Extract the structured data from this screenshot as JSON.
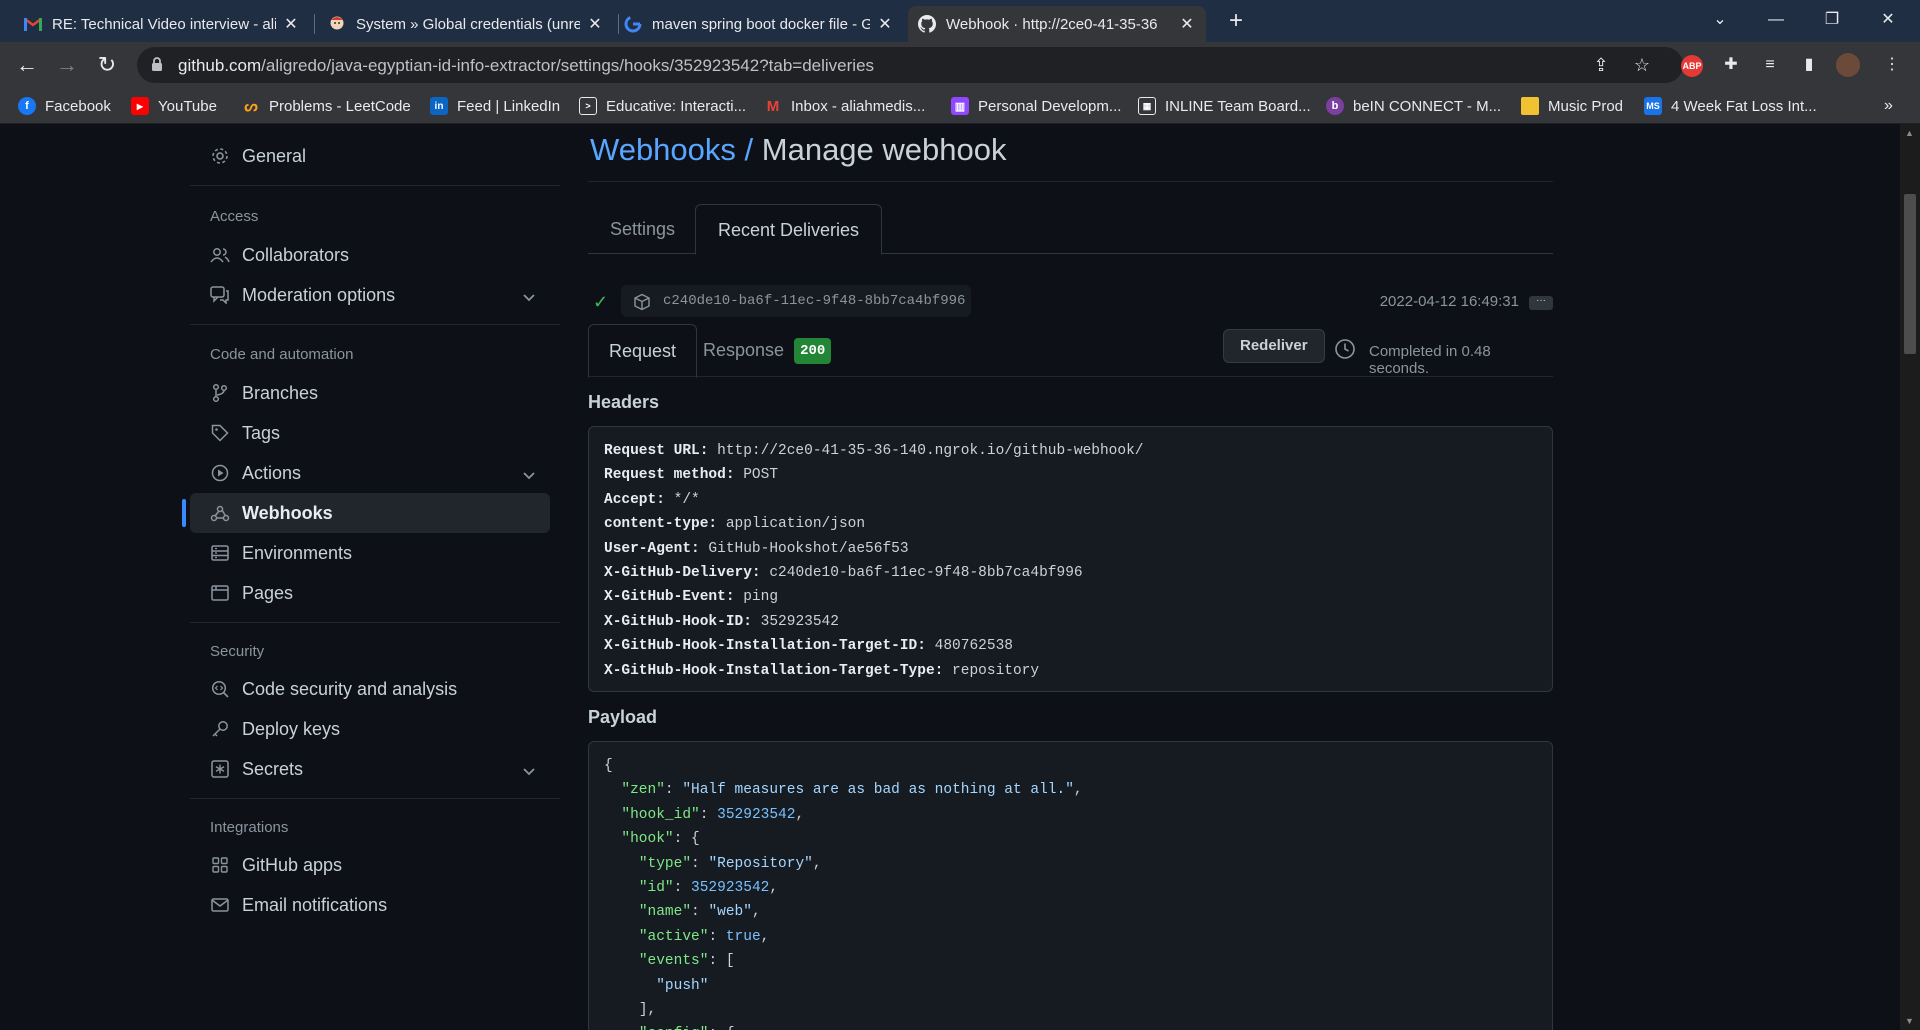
{
  "browser": {
    "tabs": [
      {
        "title": "RE: Technical Video interview - ali",
        "icon": "gmail-icon",
        "active": false
      },
      {
        "title": "System » Global credentials (unre",
        "icon": "jenkins-icon",
        "active": false
      },
      {
        "title": "maven spring boot docker file - G",
        "icon": "google-icon",
        "active": false
      },
      {
        "title": "Webhook · http://2ce0-41-35-36",
        "icon": "github-icon",
        "active": true
      }
    ],
    "url_host": "github.com",
    "url_path": "/aligredo/java-egyptian-id-info-extractor/settings/hooks/352923542?tab=deliveries",
    "bookmarks": [
      {
        "label": "Facebook",
        "icon": "facebook-icon",
        "color": "#1877f2",
        "glyph": "f"
      },
      {
        "label": "YouTube",
        "icon": "youtube-icon",
        "color": "#ff0000",
        "glyph": "▶"
      },
      {
        "label": "Problems - LeetCode",
        "icon": "leetcode-icon",
        "color": "#35363a",
        "glyph": "ᔕ"
      },
      {
        "label": "Feed | LinkedIn",
        "icon": "linkedin-icon",
        "color": "#0a66c2",
        "glyph": "in"
      },
      {
        "label": "Educative: Interacti...",
        "icon": "educative-icon",
        "color": "#35363a",
        "glyph": "▤"
      },
      {
        "label": "Inbox - aliahmedis...",
        "icon": "gmail-icon",
        "color": "#35363a",
        "glyph": "M"
      },
      {
        "label": "Personal Developm...",
        "icon": "twitch-icon",
        "color": "#9146ff",
        "glyph": "ʈ"
      },
      {
        "label": "INLINE Team Board...",
        "icon": "trello-icon",
        "color": "#35363a",
        "glyph": "▦"
      },
      {
        "label": "beIN CONNECT - M...",
        "icon": "bein-icon",
        "color": "#5c2d91",
        "glyph": "b"
      },
      {
        "label": "Music Prod",
        "icon": "folder-icon",
        "color": "#f1c232",
        "glyph": ""
      },
      {
        "label": "4 Week Fat Loss Int...",
        "icon": "ms-icon",
        "color": "#1a73e8",
        "glyph": "MS"
      }
    ]
  },
  "sidebar": {
    "general": "General",
    "access_heading": "Access",
    "collaborators": "Collaborators",
    "moderation": "Moderation options",
    "code_heading": "Code and automation",
    "branches": "Branches",
    "tags": "Tags",
    "actions": "Actions",
    "webhooks": "Webhooks",
    "environments": "Environments",
    "pages": "Pages",
    "security_heading": "Security",
    "code_security": "Code security and analysis",
    "deploy_keys": "Deploy keys",
    "secrets": "Secrets",
    "integrations_heading": "Integrations",
    "github_apps": "GitHub apps",
    "email_notifications": "Email notifications"
  },
  "main": {
    "crumb_link": "Webhooks /",
    "crumb_title": "Manage webhook",
    "tab_settings": "Settings",
    "tab_recent": "Recent Deliveries",
    "delivery_guid": "c240de10-ba6f-11ec-9f48-8bb7ca4bf996",
    "delivery_time": "2022-04-12 16:49:31",
    "more": "···",
    "tab_request": "Request",
    "tab_response": "Response",
    "response_code": "200",
    "redeliver": "Redeliver",
    "completed": "Completed in 0.48 seconds.",
    "headers_title": "Headers",
    "payload_title": "Payload"
  },
  "headers": [
    {
      "key": "Request URL:",
      "value": " http://2ce0-41-35-36-140.ngrok.io/github-webhook/"
    },
    {
      "key": "Request method:",
      "value": " POST"
    },
    {
      "key": "Accept:",
      "value": " */*"
    },
    {
      "key": "content-type:",
      "value": " application/json"
    },
    {
      "key": "User-Agent:",
      "value": " GitHub-Hookshot/ae56f53"
    },
    {
      "key": "X-GitHub-Delivery:",
      "value": " c240de10-ba6f-11ec-9f48-8bb7ca4bf996"
    },
    {
      "key": "X-GitHub-Event:",
      "value": " ping"
    },
    {
      "key": "X-GitHub-Hook-ID:",
      "value": " 352923542"
    },
    {
      "key": "X-GitHub-Hook-Installation-Target-ID:",
      "value": " 480762538"
    },
    {
      "key": "X-GitHub-Hook-Installation-Target-Type:",
      "value": " repository"
    }
  ],
  "payload": [
    {
      "indent": "",
      "key": "",
      "punct_before": "{",
      "value": "",
      "vtype": "",
      "after": ""
    },
    {
      "indent": "  ",
      "key": "\"zen\"",
      "punct_before": ": ",
      "value": "\"Half measures are as bad as nothing at all.\"",
      "vtype": "s",
      "after": ","
    },
    {
      "indent": "  ",
      "key": "\"hook_id\"",
      "punct_before": ": ",
      "value": "352923542",
      "vtype": "n",
      "after": ","
    },
    {
      "indent": "  ",
      "key": "\"hook\"",
      "punct_before": ": ",
      "value": "",
      "vtype": "",
      "after": "{"
    },
    {
      "indent": "    ",
      "key": "\"type\"",
      "punct_before": ": ",
      "value": "\"Repository\"",
      "vtype": "s",
      "after": ","
    },
    {
      "indent": "    ",
      "key": "\"id\"",
      "punct_before": ": ",
      "value": "352923542",
      "vtype": "n",
      "after": ","
    },
    {
      "indent": "    ",
      "key": "\"name\"",
      "punct_before": ": ",
      "value": "\"web\"",
      "vtype": "s",
      "after": ","
    },
    {
      "indent": "    ",
      "key": "\"active\"",
      "punct_before": ": ",
      "value": "true",
      "vtype": "n",
      "after": ","
    },
    {
      "indent": "    ",
      "key": "\"events\"",
      "punct_before": ": ",
      "value": "",
      "vtype": "",
      "after": "["
    },
    {
      "indent": "      ",
      "key": "",
      "punct_before": "",
      "value": "\"push\"",
      "vtype": "s",
      "after": ""
    },
    {
      "indent": "    ",
      "key": "",
      "punct_before": "],",
      "value": "",
      "vtype": "",
      "after": ""
    },
    {
      "indent": "    ",
      "key": "\"config\"",
      "punct_before": ": ",
      "value": "",
      "vtype": "",
      "after": "{"
    }
  ]
}
